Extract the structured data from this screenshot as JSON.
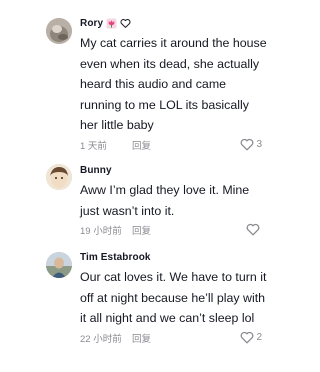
{
  "comments": [
    {
      "author": "Rory",
      "badges": [
        "tulip-icon",
        "heart-outline-icon"
      ],
      "text": "My cat carries it around the house even when its dead, she actually heard this audio and came running to me LOL its basically her little baby",
      "time": "1 天前",
      "reply_label": "回复",
      "likes": "3"
    },
    {
      "author": "Bunny",
      "badges": [],
      "text": "Aww I’m glad they love it. Mine just wasn’t into it.",
      "time": "19 小时前",
      "reply_label": "回复",
      "likes": ""
    },
    {
      "author": "Tim Estabrook",
      "badges": [],
      "text": "Our cat loves it. We have to turn it off at night because he’ll play with it all night and we can’t sleep lol",
      "time": "22 小时前",
      "reply_label": "回复",
      "likes": "2"
    }
  ],
  "colors": {
    "text": "#161823",
    "secondary": "#8a8b91",
    "tulip": "#e8427a"
  }
}
